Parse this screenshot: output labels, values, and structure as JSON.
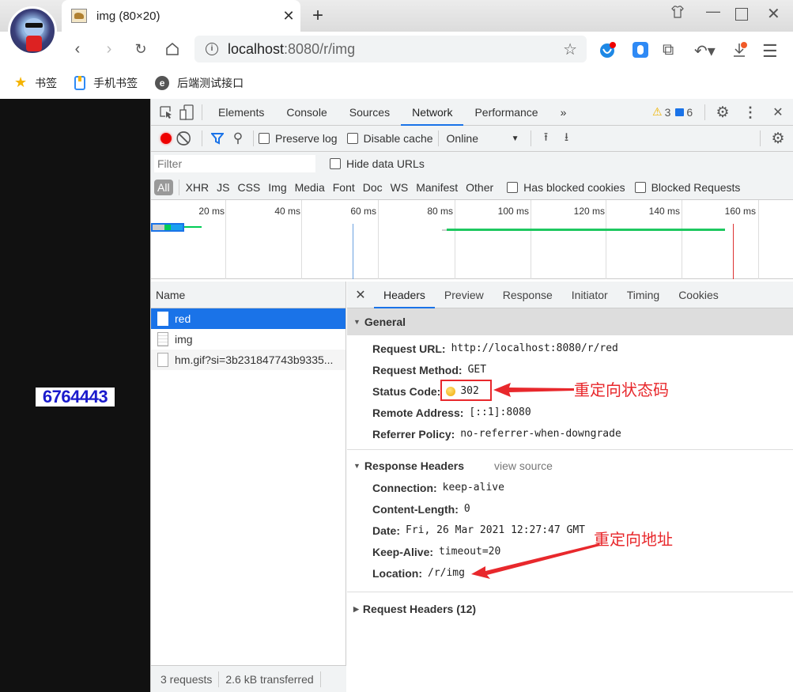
{
  "browser": {
    "tab_title": "img (80×20)",
    "url_host": "localhost",
    "url_rest": ":8080/r/img",
    "bookmarks": [
      {
        "icon": "star-icon",
        "label": "书签"
      },
      {
        "icon": "phone-bookmark-icon",
        "label": "手机书签"
      },
      {
        "icon": "e-circle-icon",
        "label": "后端测试接口"
      }
    ]
  },
  "page": {
    "captcha_text": "6764443"
  },
  "devtools": {
    "tabs": [
      "Elements",
      "Console",
      "Sources",
      "Network",
      "Performance"
    ],
    "active_tab": "Network",
    "more_tabs": "»",
    "warnings_count": "3",
    "messages_count": "6",
    "toolbar": {
      "preserve_log": "Preserve log",
      "disable_cache": "Disable cache",
      "throttle": "Online"
    },
    "filter_placeholder": "Filter",
    "hide_data_urls": "Hide data URLs",
    "types": [
      "All",
      "XHR",
      "JS",
      "CSS",
      "Img",
      "Media",
      "Font",
      "Doc",
      "WS",
      "Manifest",
      "Other"
    ],
    "has_blocked_cookies": "Has blocked cookies",
    "blocked_requests": "Blocked Requests",
    "timeline_ticks": [
      "20 ms",
      "40 ms",
      "60 ms",
      "80 ms",
      "100 ms",
      "120 ms",
      "140 ms",
      "160 ms"
    ],
    "name_header": "Name",
    "requests": [
      {
        "name": "red",
        "selected": true
      },
      {
        "name": "img",
        "selected": false
      },
      {
        "name": "hm.gif?si=3b231847743b9335...",
        "selected": false
      }
    ],
    "status": {
      "requests": "3 requests",
      "transferred": "2.6 kB transferred"
    },
    "detail_tabs": [
      "Headers",
      "Preview",
      "Response",
      "Initiator",
      "Timing",
      "Cookies"
    ],
    "general": {
      "title": "General",
      "rows": [
        {
          "k": "Request URL:",
          "v": "http://localhost:8080/r/red"
        },
        {
          "k": "Request Method:",
          "v": "GET"
        },
        {
          "k": "Status Code:",
          "v": "302"
        },
        {
          "k": "Remote Address:",
          "v": "[::1]:8080"
        },
        {
          "k": "Referrer Policy:",
          "v": "no-referrer-when-downgrade"
        }
      ]
    },
    "response_headers": {
      "title": "Response Headers",
      "view_source": "view source",
      "rows": [
        {
          "k": "Connection:",
          "v": "keep-alive"
        },
        {
          "k": "Content-Length:",
          "v": "0"
        },
        {
          "k": "Date:",
          "v": "Fri, 26 Mar 2021 12:27:47 GMT"
        },
        {
          "k": "Keep-Alive:",
          "v": "timeout=20"
        },
        {
          "k": "Location:",
          "v": "/r/img"
        }
      ]
    },
    "request_headers": {
      "title": "Request Headers (12)"
    }
  },
  "annotations": {
    "status_note": "重定向状态码",
    "location_note": "重定向地址",
    "color": "#e8282c"
  }
}
